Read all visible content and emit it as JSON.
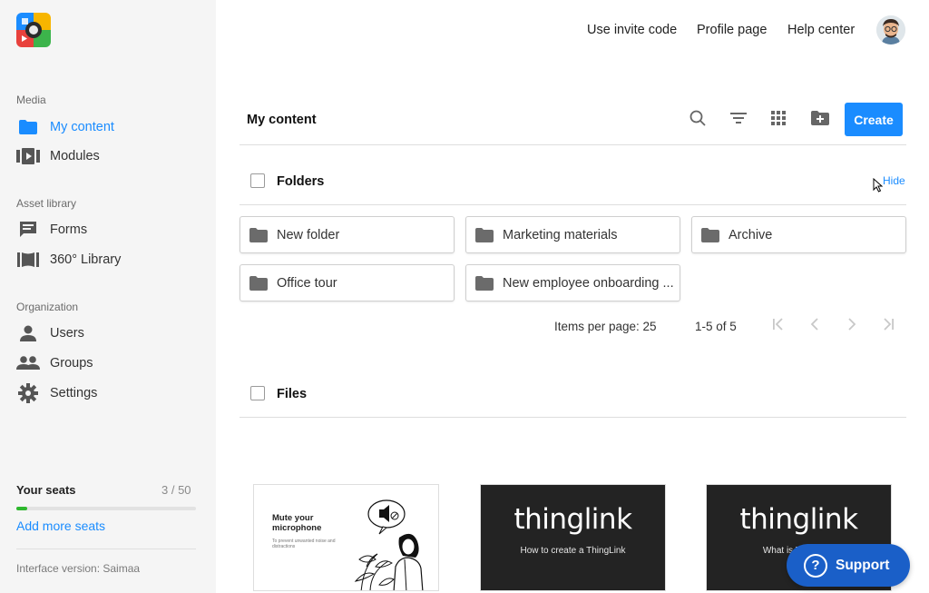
{
  "topnav": {
    "invite": "Use invite code",
    "profile": "Profile page",
    "help": "Help center"
  },
  "sidebar": {
    "media_title": "Media",
    "media_items": [
      {
        "label": "My content",
        "icon": "folder-icon",
        "active": true
      },
      {
        "label": "Modules",
        "icon": "modules-icon",
        "active": false
      }
    ],
    "asset_title": "Asset library",
    "asset_items": [
      {
        "label": "Forms",
        "icon": "forms-icon"
      },
      {
        "label": "360° Library",
        "icon": "library-360-icon"
      }
    ],
    "org_title": "Organization",
    "org_items": [
      {
        "label": "Users",
        "icon": "user-icon"
      },
      {
        "label": "Groups",
        "icon": "groups-icon"
      },
      {
        "label": "Settings",
        "icon": "gear-icon"
      }
    ],
    "seats": {
      "label": "Your seats",
      "count": "3 / 50",
      "used_fraction": 0.06
    },
    "add_seats": "Add more seats",
    "version": "Interface version: Saimaa"
  },
  "main": {
    "title": "My content",
    "tools": [
      "search-icon",
      "filter-icon",
      "grid-view-icon",
      "new-folder-icon"
    ],
    "create_label": "Create",
    "folders": {
      "heading": "Folders",
      "hide_label": "Hide",
      "items": [
        "New folder",
        "Marketing materials",
        "Archive",
        "Office tour",
        "New employee onboarding ..."
      ]
    },
    "pagination": {
      "items_per_page": "Items per page: 25",
      "range": "1-5 of 5"
    },
    "files": {
      "heading": "Files",
      "cards": [
        {
          "title": "Mute your microphone",
          "desc": "To prevent unwanted noise and distractions"
        },
        {
          "brand": "thinglink",
          "subtitle": "How to create a ThingLink"
        },
        {
          "brand": "thinglink",
          "subtitle": "What is ThingLink"
        }
      ]
    }
  },
  "support": {
    "label": "Support",
    "icon": "question-icon"
  },
  "colors": {
    "accent": "#1a8cff",
    "support": "#1a5fc8",
    "seats_bar": "#2eb82e"
  }
}
